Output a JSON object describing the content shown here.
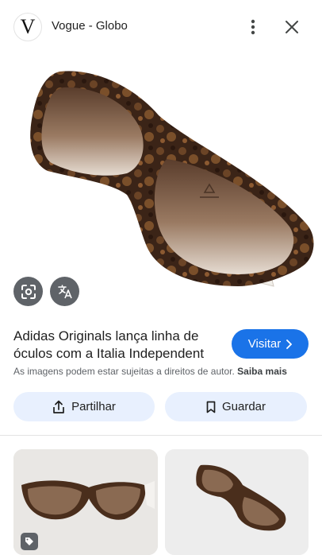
{
  "header": {
    "logo_letter": "V",
    "site_name": "Vogue - Globo",
    "more_icon": "more-vert-icon",
    "close_icon": "close-icon"
  },
  "image_actions": {
    "lens_icon": "google-lens-icon",
    "translate_icon": "translate-icon"
  },
  "result": {
    "title": "Adidas Originals lança linha de óculos com a Italia Independent",
    "visit_label": "Visitar",
    "copyright_text": "As imagens podem estar sujeitas a direitos de autor.",
    "learn_more": "Saiba mais"
  },
  "actions": {
    "share_label": "Partilhar",
    "save_label": "Guardar"
  },
  "colors": {
    "accent": "#1a73e8",
    "pill_bg": "#e8f0fe",
    "icon_bg": "#5f6368"
  }
}
